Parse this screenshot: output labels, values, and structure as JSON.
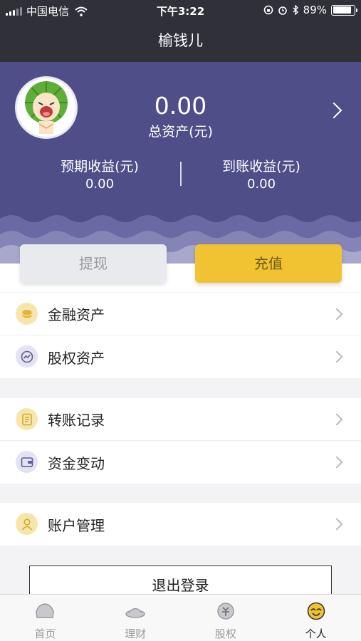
{
  "status_bar": {
    "carrier": "中国电信",
    "time": "下午3:22",
    "battery": "89%",
    "battery_level": 0.89
  },
  "nav": {
    "title": "榆钱儿"
  },
  "account": {
    "total_value": "0.00",
    "total_label": "总资产(元)",
    "expected_label": "预期收益(元)",
    "expected_value": "0.00",
    "received_label": "到账收益(元)",
    "received_value": "0.00"
  },
  "actions": {
    "withdraw": "提现",
    "recharge": "充值"
  },
  "menu": {
    "financial_assets": "金融资产",
    "equity_assets": "股权资产",
    "transfer_records": "转账记录",
    "fund_changes": "资金变动",
    "account_management": "账户管理"
  },
  "logout": "退出登录",
  "tabs": [
    {
      "label": "首页",
      "icon": "home-icon"
    },
    {
      "label": "理财",
      "icon": "finance-icon"
    },
    {
      "label": "股权",
      "icon": "equity-icon"
    },
    {
      "label": "个人",
      "icon": "profile-icon"
    }
  ],
  "colors": {
    "header_bg": "#2f3038",
    "hero_bg": "#4f4e88",
    "accent_yellow": "#f1c232",
    "icon_yellow_bg": "#f7e6ac",
    "icon_purple_bg": "#e3e3f1"
  }
}
